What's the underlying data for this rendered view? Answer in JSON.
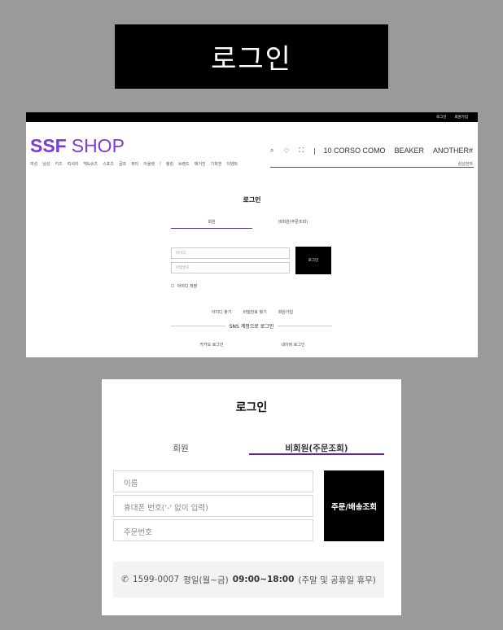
{
  "banner": {
    "title": "로그인"
  },
  "site": {
    "topbar": {
      "login": "로그인",
      "join": "회원가입"
    },
    "logo": {
      "bold": "SSF",
      "light": "SHOP"
    },
    "header_icons": {
      "search": "⌕",
      "heart": "♡",
      "bag": "⛶",
      "sep": "|"
    },
    "brands": [
      "10 CORSO COMO",
      "BEAKER",
      "ANOTHER#"
    ],
    "nav": [
      "여성",
      "남성",
      "키즈",
      "럭셔리",
      "백&슈즈",
      "스포츠",
      "골프",
      "뷰티",
      "아울렛",
      "|",
      "랭킹",
      "브랜드",
      "매거진",
      "기획전",
      "이벤트"
    ],
    "nav_right": "삼성전자",
    "login_title": "로그인",
    "tabs": [
      "회원",
      "비회원(주문조회)"
    ],
    "id_placeholder": "아이디",
    "pw_placeholder": "비밀번호",
    "login_button": "로그인",
    "save_id": "아이디 저장",
    "links": [
      "아이디 찾기",
      "비밀번호 찾기",
      "회원가입"
    ],
    "sns": "SNS 계정으로 로그인",
    "social": [
      "카카오 로그인",
      "네이버 로그인"
    ]
  },
  "card": {
    "title": "로그인",
    "tabs": {
      "member": "회원",
      "guest": "비회원(주문조회)"
    },
    "fields": {
      "name": "이름",
      "phone": "휴대폰 번호('-' 없이 입력)",
      "order": "주문번호"
    },
    "submit": "주문/배송조회",
    "hours": {
      "phone_icon": "✆",
      "phone": "1599-0007",
      "days": "평일(월~금)",
      "time": "09:00~18:00",
      "note": "(주말 및 공휴일 휴무)"
    }
  },
  "colors": {
    "brand": "#7c3ad6",
    "tab_underline": "#6b1b93"
  }
}
